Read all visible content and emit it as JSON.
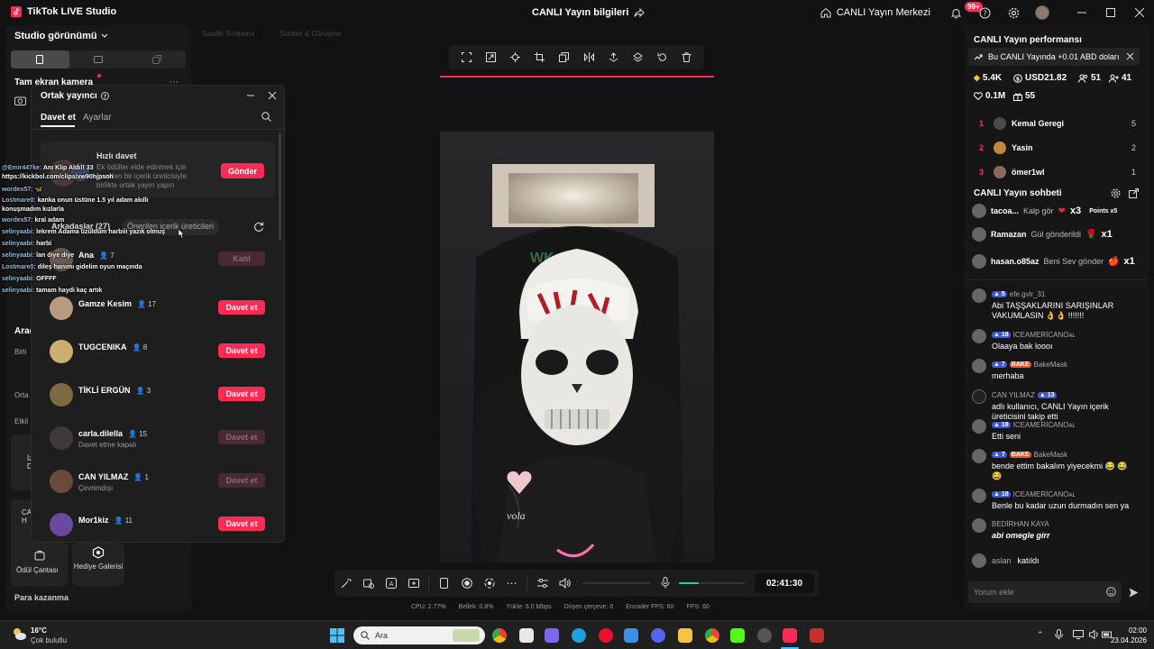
{
  "titlebar": {
    "app_name": "TikTok LIVE Studio",
    "center_title": "CANLI Yayın bilgileri",
    "live_center": "CANLI Yayın Merkezi",
    "notif_badge": "99+"
  },
  "left": {
    "studio_view": "Studio görünümü",
    "fullscreen_camera": "Tam ekran kamera",
    "tools_label": "Araç",
    "row_labels": [
      "Birli",
      "Orta",
      "Etkil"
    ],
    "side_btn_1": "İz Di",
    "side_btn_2": "CAN H",
    "reward_bag": "Ödül Çantası",
    "gift_gallery": "Hediye Galerisi",
    "earn_money": "Para kazanma"
  },
  "faded_tabs": [
    "Saatlik Sıralama",
    "Sohbet & Görüşme"
  ],
  "dialog": {
    "title": "Ortak yayıncı",
    "tab_invite": "Davet et",
    "tab_settings": "Ayarlar",
    "quick_invite": "Hızlı davet",
    "quick_desc": "Ek ödüller elde edinmek için önerilen bir içerik üreticisiyle birlikte ortak yayın yapın",
    "send": "Gönder",
    "friends_tab": "Arkadaşlar (27)",
    "suggested_tab": "Önerilen içerik üreticileri",
    "join": "Katıl",
    "invite_label": "Davet et",
    "friends": [
      {
        "name": "Ana",
        "count": "7",
        "sub": "",
        "state": "join"
      },
      {
        "name": "Gamze Kesim",
        "count": "17",
        "sub": "",
        "state": "active"
      },
      {
        "name": "TUGCENIKA",
        "count": "8",
        "sub": "",
        "state": "active"
      },
      {
        "name": "TİKLİ ERGÜN",
        "count": "3",
        "sub": "",
        "state": "active"
      },
      {
        "name": "carla.dilella",
        "count": "15",
        "sub": "Davet etme kapalı",
        "state": "disabled"
      },
      {
        "name": "CAN YILMAZ",
        "count": "1",
        "sub": "Çevrimdışı",
        "state": "disabled"
      },
      {
        "name": "Mor1kiz",
        "count": "11",
        "sub": "",
        "state": "active"
      }
    ]
  },
  "overlay_chat": [
    {
      "user": "@Emir447ke:",
      "text": "Anı Klip Aldı!! 33"
    },
    {
      "user": "",
      "text": "https://kickbol.com/clips/xw90hjpsoh"
    },
    {
      "user": "wordex57:",
      "text": "🦋"
    },
    {
      "user": "Lostmare0:",
      "text": "kanka onun üstüne 1.5 yıl adam akıllı"
    },
    {
      "user": "",
      "text": "konuşmadım kızlarla"
    },
    {
      "user": "wordex57:",
      "text": "kral adam"
    },
    {
      "user": "selinyaabi:",
      "text": "lekrem Adama üzüldüm harbiii yazık olmuş"
    },
    {
      "user": "selinyaabi:",
      "text": "harbi"
    },
    {
      "user": "selinyaabi:",
      "text": "lan diye diye"
    },
    {
      "user": "Lostmare0:",
      "text": "dileş hanımı gidelim oyun maçında"
    },
    {
      "user": "selinyaabi:",
      "text": "OFFFF"
    },
    {
      "user": "selinyaabi:",
      "text": "tamam haydi kaç artık"
    }
  ],
  "controls": {
    "timer": "02:41:30",
    "volume_level": 0.3
  },
  "stats": {
    "cpu": "CPU: 2.77%",
    "memory": "Bellek: 0.8%",
    "upload": "Yükle: 6.0 Mbps",
    "dropped": "Düşen çerçeve: 0",
    "encoder": "Encoder FPS: 60",
    "fps": "FPS: 60"
  },
  "right": {
    "perf_title": "CANLI Yayın performansı",
    "earnings": "Bu CANLI Yayında +0.01 ABD doları",
    "diamonds": "5.4K",
    "usd": "USD21.82",
    "viewers": "51",
    "new_followers": "41",
    "likes": "0.1M",
    "gifts": "55",
    "ranks": [
      {
        "rank": "1",
        "name": "Kemal Geregi",
        "value": "5"
      },
      {
        "rank": "2",
        "name": "Yasin",
        "value": "2"
      },
      {
        "rank": "3",
        "name": "ömer1wl",
        "value": "1"
      }
    ],
    "chat_title": "CANLI Yayın sohbeti",
    "gift_events": [
      {
        "user": "tacoa...",
        "action": "Kalp gör",
        "mult": "x3",
        "extra": "Points x5"
      },
      {
        "user": "Ramazan",
        "action": "Gül gönderildi",
        "mult": "x1",
        "extra": ""
      },
      {
        "user": "hasan.o85az",
        "action": "Beni Sev gönder",
        "mult": "x1",
        "extra": ""
      }
    ],
    "messages": [
      {
        "level": "5",
        "badge": "",
        "user": "efe.gvlr_31",
        "text": "Abi TAŞŞAKLARINI SARIŞINLAR VAKUMLASIN 👌👌 !!!!!!!"
      },
      {
        "level": "18",
        "badge": "",
        "user": "ICEAMERİCANOᴀʟ",
        "text": "Olaaya bak loooı"
      },
      {
        "level": "7",
        "badge": "BAKE",
        "user": "BakeMask",
        "text": "merhaba"
      },
      {
        "level": "13",
        "badge": "",
        "user": "CAN YILMAZ",
        "text": "adlı kullanıcı, CANLI Yayın içerik üreticisini takip etti"
      },
      {
        "level": "18",
        "badge": "",
        "user": "ICEAMERİCANOᴀʟ",
        "text": "Etti seni"
      },
      {
        "level": "7",
        "badge": "BAKE",
        "user": "BakeMask",
        "text": "bende ettim bakalım yiyecekmi 😂 😂 😂"
      },
      {
        "level": "18",
        "badge": "",
        "user": "ICEAMERİCANOᴀʟ",
        "text": "Benle bu kadar uzun durmadın sen ya"
      },
      {
        "level": "",
        "badge": "",
        "user": "BEDİRHAN KAYA",
        "text": "abi omegle girr"
      },
      {
        "level": "",
        "badge": "",
        "user": "aslan",
        "text": "katıldı"
      }
    ],
    "comment_placeholder": "Yorum ekle"
  },
  "taskbar": {
    "weather_temp": "16°C",
    "weather_desc": "Çok bulutlu",
    "search": "Ara",
    "time": "02:00",
    "date": "23.04.2026"
  }
}
